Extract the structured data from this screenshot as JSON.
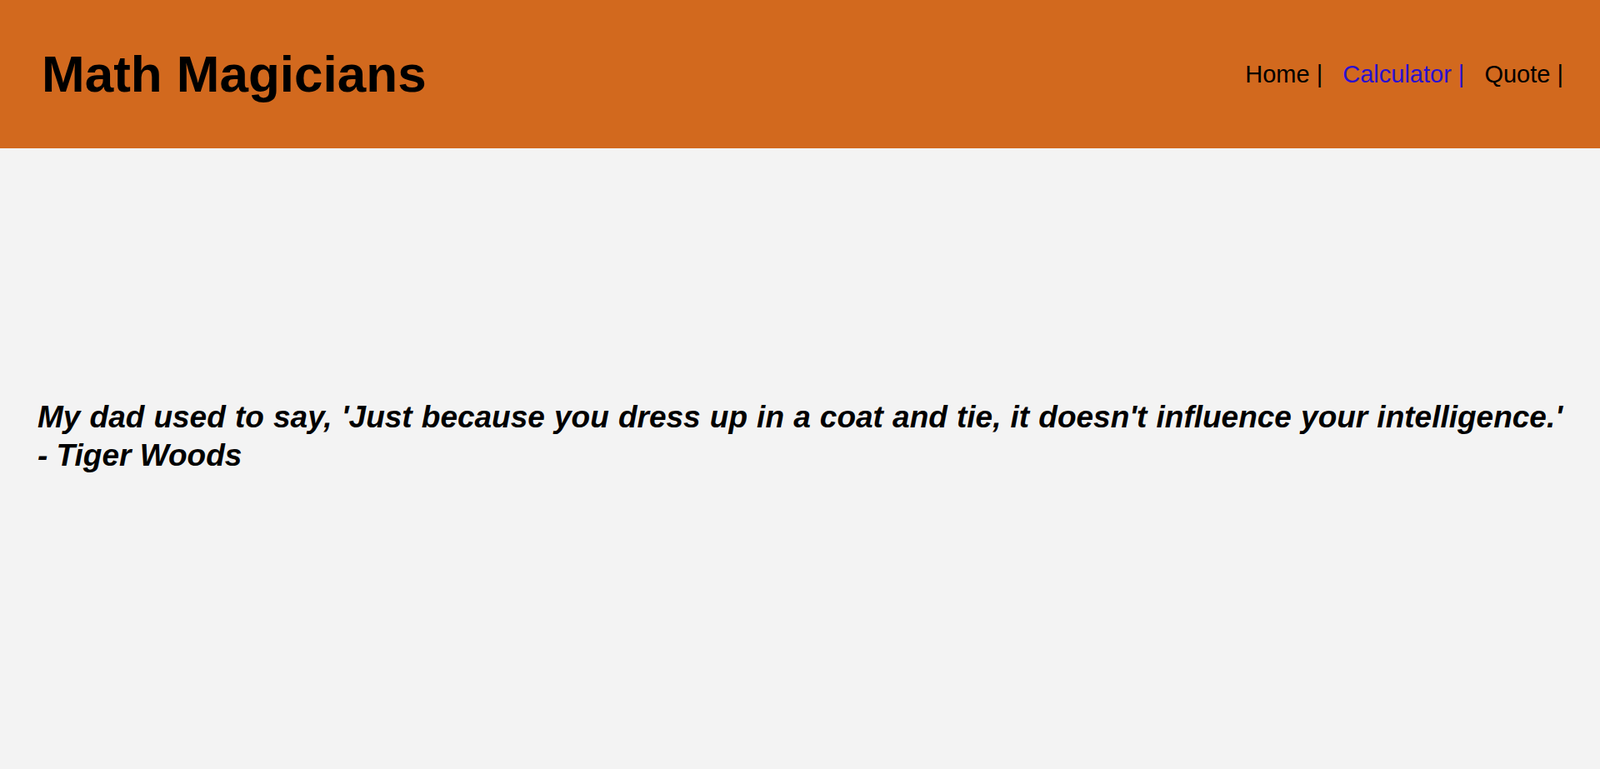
{
  "header": {
    "title": "Math Magicians"
  },
  "nav": {
    "items": [
      {
        "label": "Home |",
        "color": "#000000"
      },
      {
        "label": "Calculator |",
        "color": "#2a10d0"
      },
      {
        "label": "Quote |",
        "color": "#000000"
      }
    ]
  },
  "quote": {
    "text": "My dad used to say, 'Just because you dress up in a coat and tie, it doesn't influence your intelligence.' - Tiger Woods"
  }
}
